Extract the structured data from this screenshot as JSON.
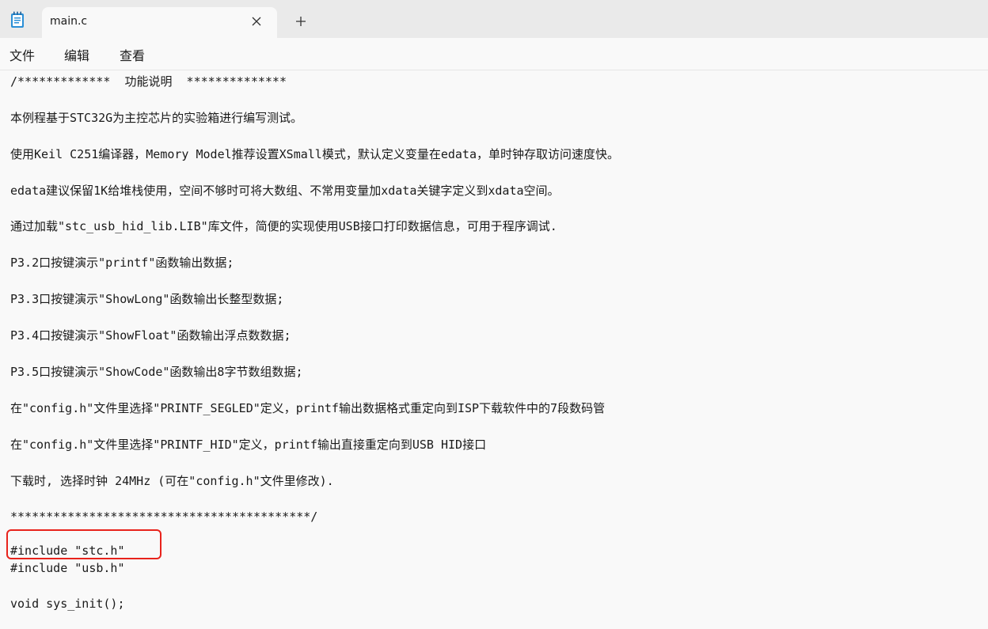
{
  "window": {
    "tab_title": "main.c",
    "icons": {
      "app": "notepad-icon",
      "close": "close-icon",
      "new_tab": "plus-icon"
    }
  },
  "menu": {
    "items": [
      "文件",
      "编辑",
      "查看"
    ]
  },
  "editor": {
    "lines": [
      "/*************  功能说明  **************",
      "本例程基于STC32G为主控芯片的实验箱进行编写测试。",
      "使用Keil C251编译器，Memory Model推荐设置XSmall模式，默认定义变量在edata，单时钟存取访问速度快。",
      "edata建议保留1K给堆栈使用，空间不够时可将大数组、不常用变量加xdata关键字定义到xdata空间。",
      "通过加载\"stc_usb_hid_lib.LIB\"库文件，简便的实现使用USB接口打印数据信息，可用于程序调试.",
      "P3.2口按键演示\"printf\"函数输出数据;",
      "P3.3口按键演示\"ShowLong\"函数输出长整型数据;",
      "P3.4口按键演示\"ShowFloat\"函数输出浮点数数据;",
      "P3.5口按键演示\"ShowCode\"函数输出8字节数组数据;",
      "在\"config.h\"文件里选择\"PRINTF_SEGLED\"定义，printf输出数据格式重定向到ISP下载软件中的7段数码管",
      "在\"config.h\"文件里选择\"PRINTF_HID\"定义，printf输出直接重定向到USB HID接口",
      "下载时, 选择时钟 24MHz (可在\"config.h\"文件里修改).",
      "******************************************/",
      "#include \"stc.h\"",
      "#include \"usb.h\"",
      "void sys_init();"
    ]
  },
  "colors": {
    "titlebar": "#eaeaea",
    "background": "#f9f9f9",
    "highlight": "#e8231c"
  }
}
